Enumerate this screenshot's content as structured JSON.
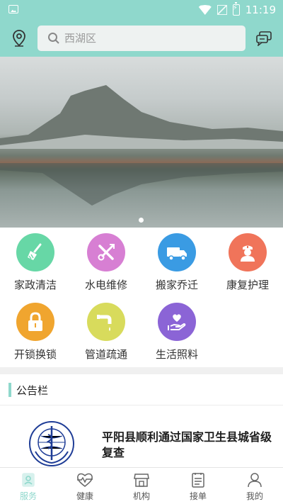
{
  "status_bar": {
    "time": "11:19"
  },
  "header": {
    "search_placeholder": "西湖区"
  },
  "banner": {
    "slide_index": 1,
    "slide_count": 1
  },
  "services": [
    {
      "label": "家政清洁",
      "icon": "broom-icon",
      "color": "#67d7a6"
    },
    {
      "label": "水电维修",
      "icon": "tools-icon",
      "color": "#d77fd3"
    },
    {
      "label": "搬家乔迁",
      "icon": "truck-icon",
      "color": "#3a9be3"
    },
    {
      "label": "康复护理",
      "icon": "nurse-icon",
      "color": "#f0745a"
    },
    {
      "label": "开锁换锁",
      "icon": "lock-icon",
      "color": "#f0a52f"
    },
    {
      "label": "管道疏通",
      "icon": "pipe-icon",
      "color": "#d8db5c"
    },
    {
      "label": "生活照料",
      "icon": "heart-hand-icon",
      "color": "#8b64d6"
    }
  ],
  "notice": {
    "title": "公告栏",
    "items": [
      {
        "headline": "平阳县顺利通过国家卫生县城省级复查"
      }
    ]
  },
  "bottom_nav": [
    {
      "label": "服务",
      "icon": "service-icon",
      "active": true
    },
    {
      "label": "健康",
      "icon": "heartbeat-icon",
      "active": false
    },
    {
      "label": "机构",
      "icon": "store-icon",
      "active": false
    },
    {
      "label": "接单",
      "icon": "order-icon",
      "active": false
    },
    {
      "label": "我的",
      "icon": "user-icon",
      "active": false
    }
  ],
  "colors": {
    "accent": "#8fd8cc",
    "inactive": "#555555"
  }
}
